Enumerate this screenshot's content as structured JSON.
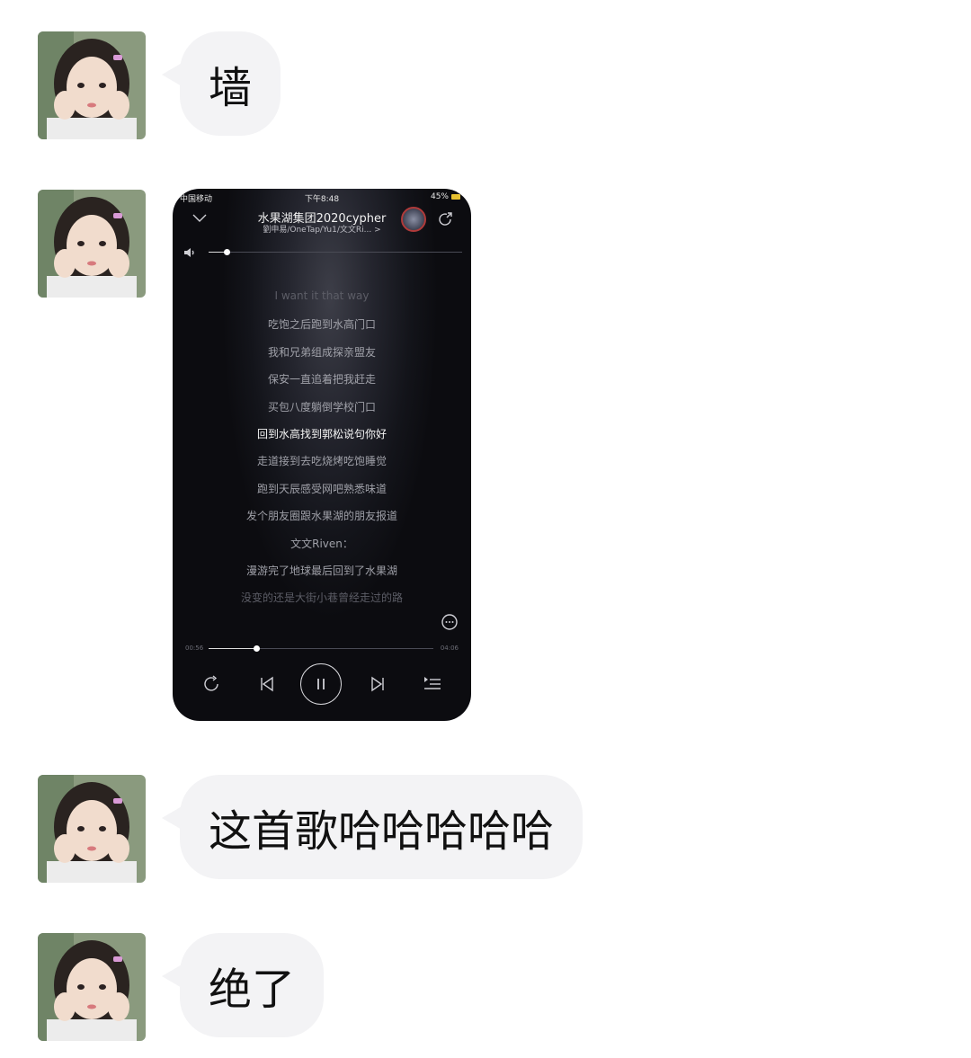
{
  "messages": [
    {
      "type": "text",
      "text": "墙"
    },
    {
      "type": "image"
    },
    {
      "type": "text",
      "text": "这首歌哈哈哈哈哈"
    },
    {
      "type": "text",
      "text": "绝了"
    }
  ],
  "phone": {
    "status": {
      "carrier": "中国移动",
      "time": "下午8:48",
      "battery": "45%"
    },
    "song_title": "水果湖集团2020cypher",
    "artists": "劉申易/OneTap/Yu1/文文Ri... >",
    "lyrics": [
      "I want it that way",
      "吃饱之后跑到水高门口",
      "我和兄弟组成探亲盟友",
      "保安一直追着把我赶走",
      "买包八度躺倒学校门口",
      "回到水高找到郭松说句你好",
      "走道接到去吃烧烤吃饱睡觉",
      "跑到天辰感受网吧熟悉味道",
      "发个朋友圈跟水果湖的朋友报道",
      "文文Riven：",
      "漫游完了地球最后回到了水果湖",
      "没变的还是大街小巷曾经走过的路"
    ],
    "current_lyric_index": 5,
    "elapsed": "00:56",
    "duration": "04:06",
    "progress": 0.21,
    "volume": 0.07
  },
  "colors": {
    "bubble": "#f3f3f5",
    "background": "#ffffff"
  }
}
